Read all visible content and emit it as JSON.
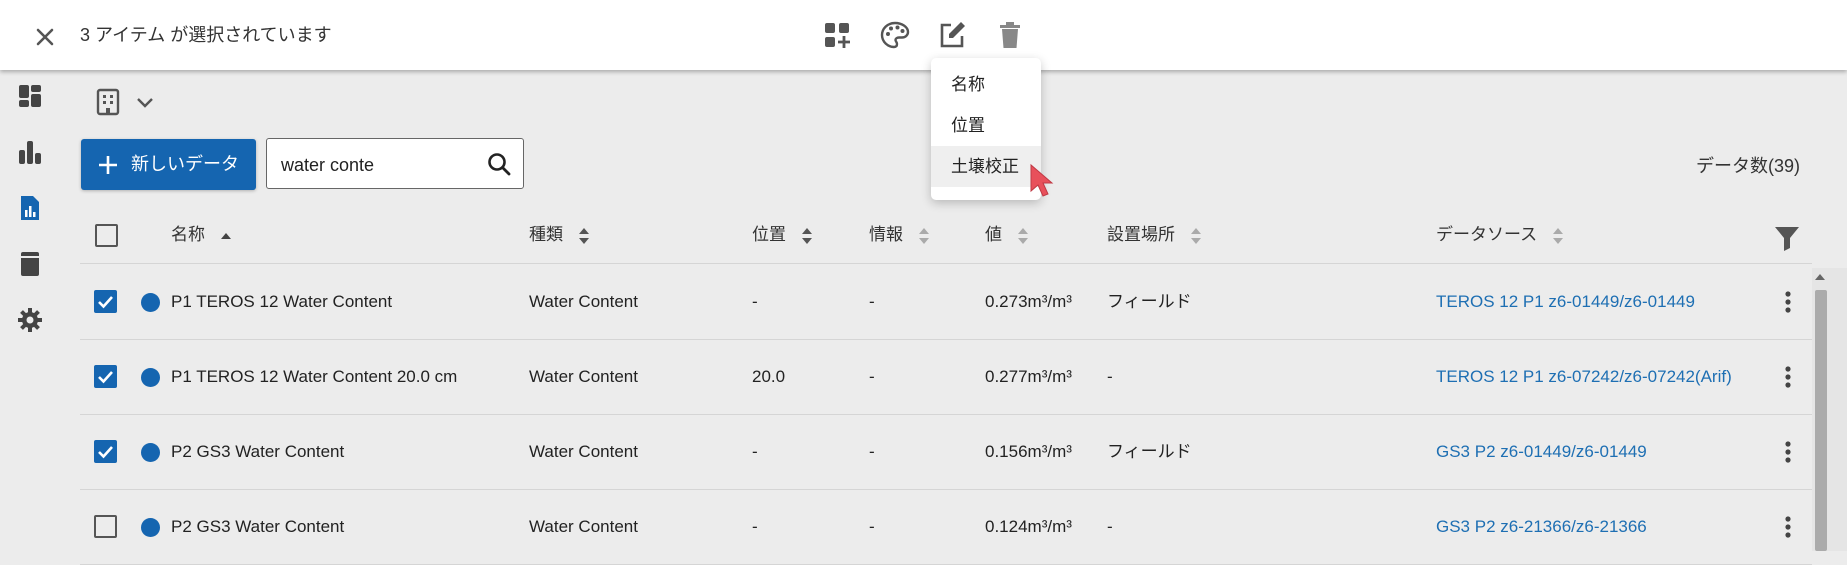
{
  "selection_bar": {
    "text": "3 アイテム が選択されています",
    "icons": [
      "close-icon",
      "dashboard-add-icon",
      "palette-icon",
      "edit-icon",
      "delete-icon"
    ]
  },
  "edit_menu": {
    "items": [
      "名称",
      "位置",
      "土壌校正"
    ],
    "hovered": "土壌校正"
  },
  "sidebar": {
    "icons": [
      "dashboard-icon",
      "bar-chart-icon",
      "report-icon",
      "device-icon",
      "settings-icon"
    ],
    "active": "report-icon"
  },
  "toolbar": {
    "new_data_label": "新しいデータ",
    "search_value": "water conte",
    "count_label": "データ数(39)"
  },
  "table": {
    "columns": [
      "名称",
      "種類",
      "位置",
      "情報",
      "値",
      "設置場所",
      "データソース"
    ],
    "sorted_column": "名称",
    "rows": [
      {
        "checked": true,
        "name": "P1 TEROS 12 Water Content",
        "type": "Water Content",
        "position": "-",
        "info": "-",
        "value": "0.273m³/m³",
        "location": "フィールド",
        "source": "TEROS 12 P1 z6-01449/z6-01449"
      },
      {
        "checked": true,
        "name": "P1 TEROS 12 Water Content 20.0 cm",
        "type": "Water Content",
        "position": "20.0",
        "info": "-",
        "value": "0.277m³/m³",
        "location": "-",
        "source": "TEROS 12 P1 z6-07242/z6-07242(Arif)"
      },
      {
        "checked": true,
        "name": "P2 GS3 Water Content",
        "type": "Water Content",
        "position": "-",
        "info": "-",
        "value": "0.156m³/m³",
        "location": "フィールド",
        "source": "GS3 P2 z6-01449/z6-01449"
      },
      {
        "checked": false,
        "name": "P2 GS3 Water Content",
        "type": "Water Content",
        "position": "-",
        "info": "-",
        "value": "0.124m³/m³",
        "location": "-",
        "source": "GS3 P2 z6-21366/z6-21366"
      }
    ]
  },
  "colors": {
    "primary": "#1565b0",
    "link": "#1e6fb3",
    "background": "#ececec",
    "cursor": "#e8505b"
  }
}
